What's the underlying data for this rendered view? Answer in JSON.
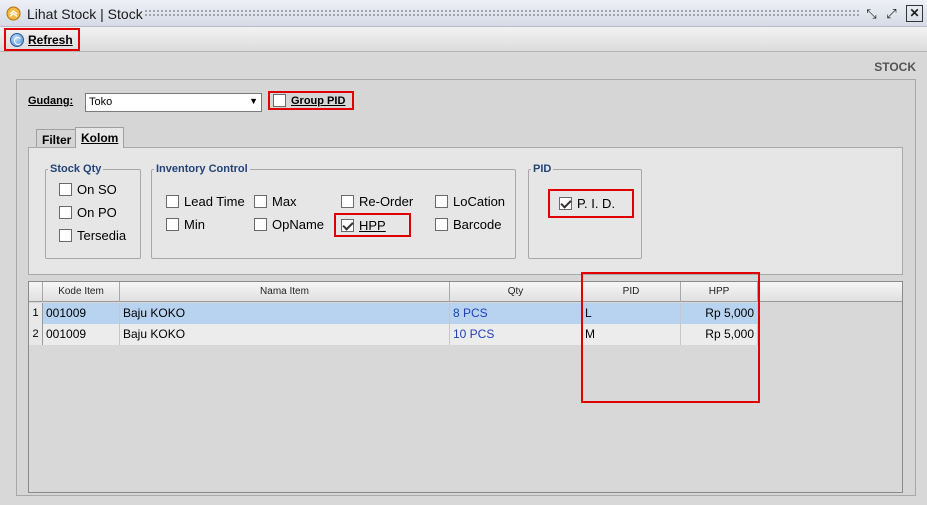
{
  "window": {
    "title": "Lihat Stock | Stock",
    "controls": [
      "restore-icon",
      "maximize-icon",
      "close-icon"
    ]
  },
  "toolbar": {
    "refresh_label": "Refresh"
  },
  "section_label": "STOCK",
  "gudang": {
    "label": "Gudang:",
    "value": "Toko"
  },
  "group_pid": {
    "label": "Group PID",
    "checked": false
  },
  "tabs": [
    {
      "label": "Filter",
      "active": false
    },
    {
      "label": "Kolom",
      "active": true
    }
  ],
  "groups": {
    "stock_qty": {
      "title": "Stock Qty",
      "options": [
        {
          "label": "On SO",
          "checked": false
        },
        {
          "label": "On PO",
          "checked": false
        },
        {
          "label": "Tersedia",
          "checked": false
        }
      ]
    },
    "inventory_control": {
      "title": "Inventory Control",
      "options": [
        {
          "label": "Lead Time",
          "checked": false
        },
        {
          "label": "Max",
          "checked": false
        },
        {
          "label": "Re-Order",
          "checked": false
        },
        {
          "label": "LoCation",
          "checked": false
        },
        {
          "label": "Min",
          "checked": false
        },
        {
          "label": "OpName",
          "checked": false
        },
        {
          "label": "HPP",
          "checked": true
        },
        {
          "label": "Barcode",
          "checked": false
        }
      ]
    },
    "pid": {
      "title": "PID",
      "options": [
        {
          "label": "P. I. D.",
          "checked": true
        }
      ]
    }
  },
  "table": {
    "columns": [
      "Kode Item",
      "Nama Item",
      "Qty",
      "PID",
      "HPP"
    ],
    "rows": [
      {
        "no": "1",
        "kode": "001009",
        "nama": "Baju KOKO",
        "qty": "8 PCS",
        "pid": "L",
        "hpp": "Rp 5,000"
      },
      {
        "no": "2",
        "kode": "001009",
        "nama": "Baju KOKO",
        "qty": "10 PCS",
        "pid": "M",
        "hpp": "Rp 5,000"
      }
    ]
  },
  "colors": {
    "highlight": "#e00000",
    "selected_row": "#b7d3f0",
    "qty_text": "#1f3fb8",
    "group_title": "#224477"
  }
}
